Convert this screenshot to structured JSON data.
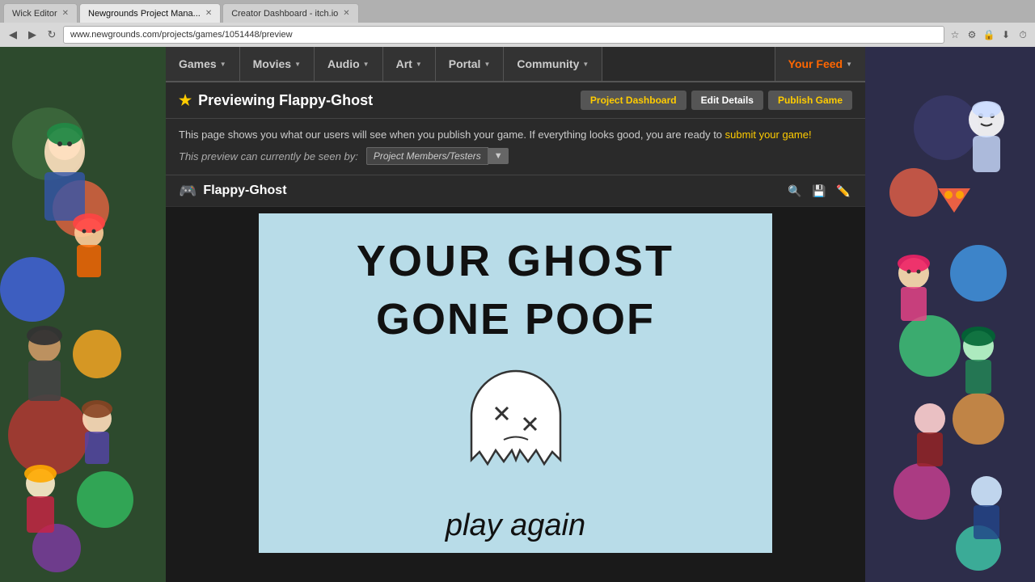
{
  "browser": {
    "tabs": [
      {
        "label": "Wick Editor",
        "active": false
      },
      {
        "label": "Newgrounds Project Mana...",
        "active": true
      },
      {
        "label": "Creator Dashboard - itch.io",
        "active": false
      }
    ],
    "url": "www.newgrounds.com/projects/games/1051448/preview"
  },
  "nav": {
    "items": [
      {
        "label": "Games",
        "arrow": true
      },
      {
        "label": "Movies",
        "arrow": true
      },
      {
        "label": "Audio",
        "arrow": true
      },
      {
        "label": "Art",
        "arrow": true
      },
      {
        "label": "Portal",
        "arrow": true
      },
      {
        "label": "Community",
        "arrow": true
      }
    ],
    "your_feed": "Your Feed"
  },
  "preview": {
    "star": "★",
    "title": "Previewing Flappy-Ghost",
    "btn_dashboard": "Project Dashboard",
    "btn_edit": "Edit Details",
    "btn_publish": "Publish Game",
    "info_text": "This page shows you what our users will see when you publish your game. If everything looks good, you are ready to",
    "info_link": "submit your game!",
    "visibility_label": "This preview can currently be seen by:",
    "visibility_option": "Project Members/Testers",
    "visibility_arrow": "▼"
  },
  "game": {
    "icon": "🎮",
    "title": "Flappy-Ghost",
    "tool_search": "🔍",
    "tool_save": "💾",
    "tool_edit": "✏️",
    "canvas_text_line1": "YOUR GHOST",
    "canvas_text_line2": "GONE POOF",
    "canvas_play_again": "play again"
  },
  "side_left": {
    "description": "decorative character art panel"
  },
  "side_right": {
    "description": "decorative character art panel"
  }
}
